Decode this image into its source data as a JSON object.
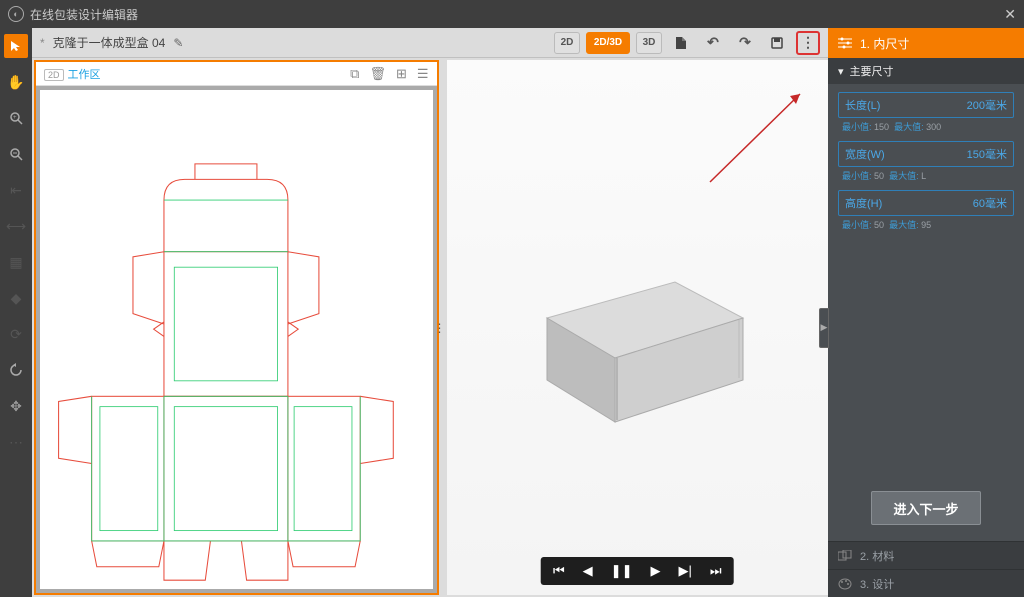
{
  "title": "在线包装设计编辑器",
  "docbar": {
    "star": "*",
    "doc_name": "克隆于一体成型盒 04"
  },
  "view_buttons": {
    "v2d": "2D",
    "v2d3d": "2D/3D",
    "v3d": "3D"
  },
  "panel2d": {
    "num": "2D",
    "label": "工作区"
  },
  "right": {
    "head_label": "1. 内尺寸",
    "sub_label": "主要尺寸",
    "dims": [
      {
        "name": "长度(L)",
        "value": "200毫米",
        "hint_min_label": "最小值:",
        "hint_min": "150",
        "hint_max_label": "最大值:",
        "hint_max": "300"
      },
      {
        "name": "宽度(W)",
        "value": "150毫米",
        "hint_min_label": "最小值:",
        "hint_min": "50",
        "hint_max_label": "最大值:",
        "hint_max": "L"
      },
      {
        "name": "高度(H)",
        "value": "60毫米",
        "hint_min_label": "最小值:",
        "hint_min": "50",
        "hint_max_label": "最大值:",
        "hint_max": "95"
      }
    ],
    "next": "进入下一步",
    "step2": "2. 材料",
    "step3": "3. 设计"
  }
}
